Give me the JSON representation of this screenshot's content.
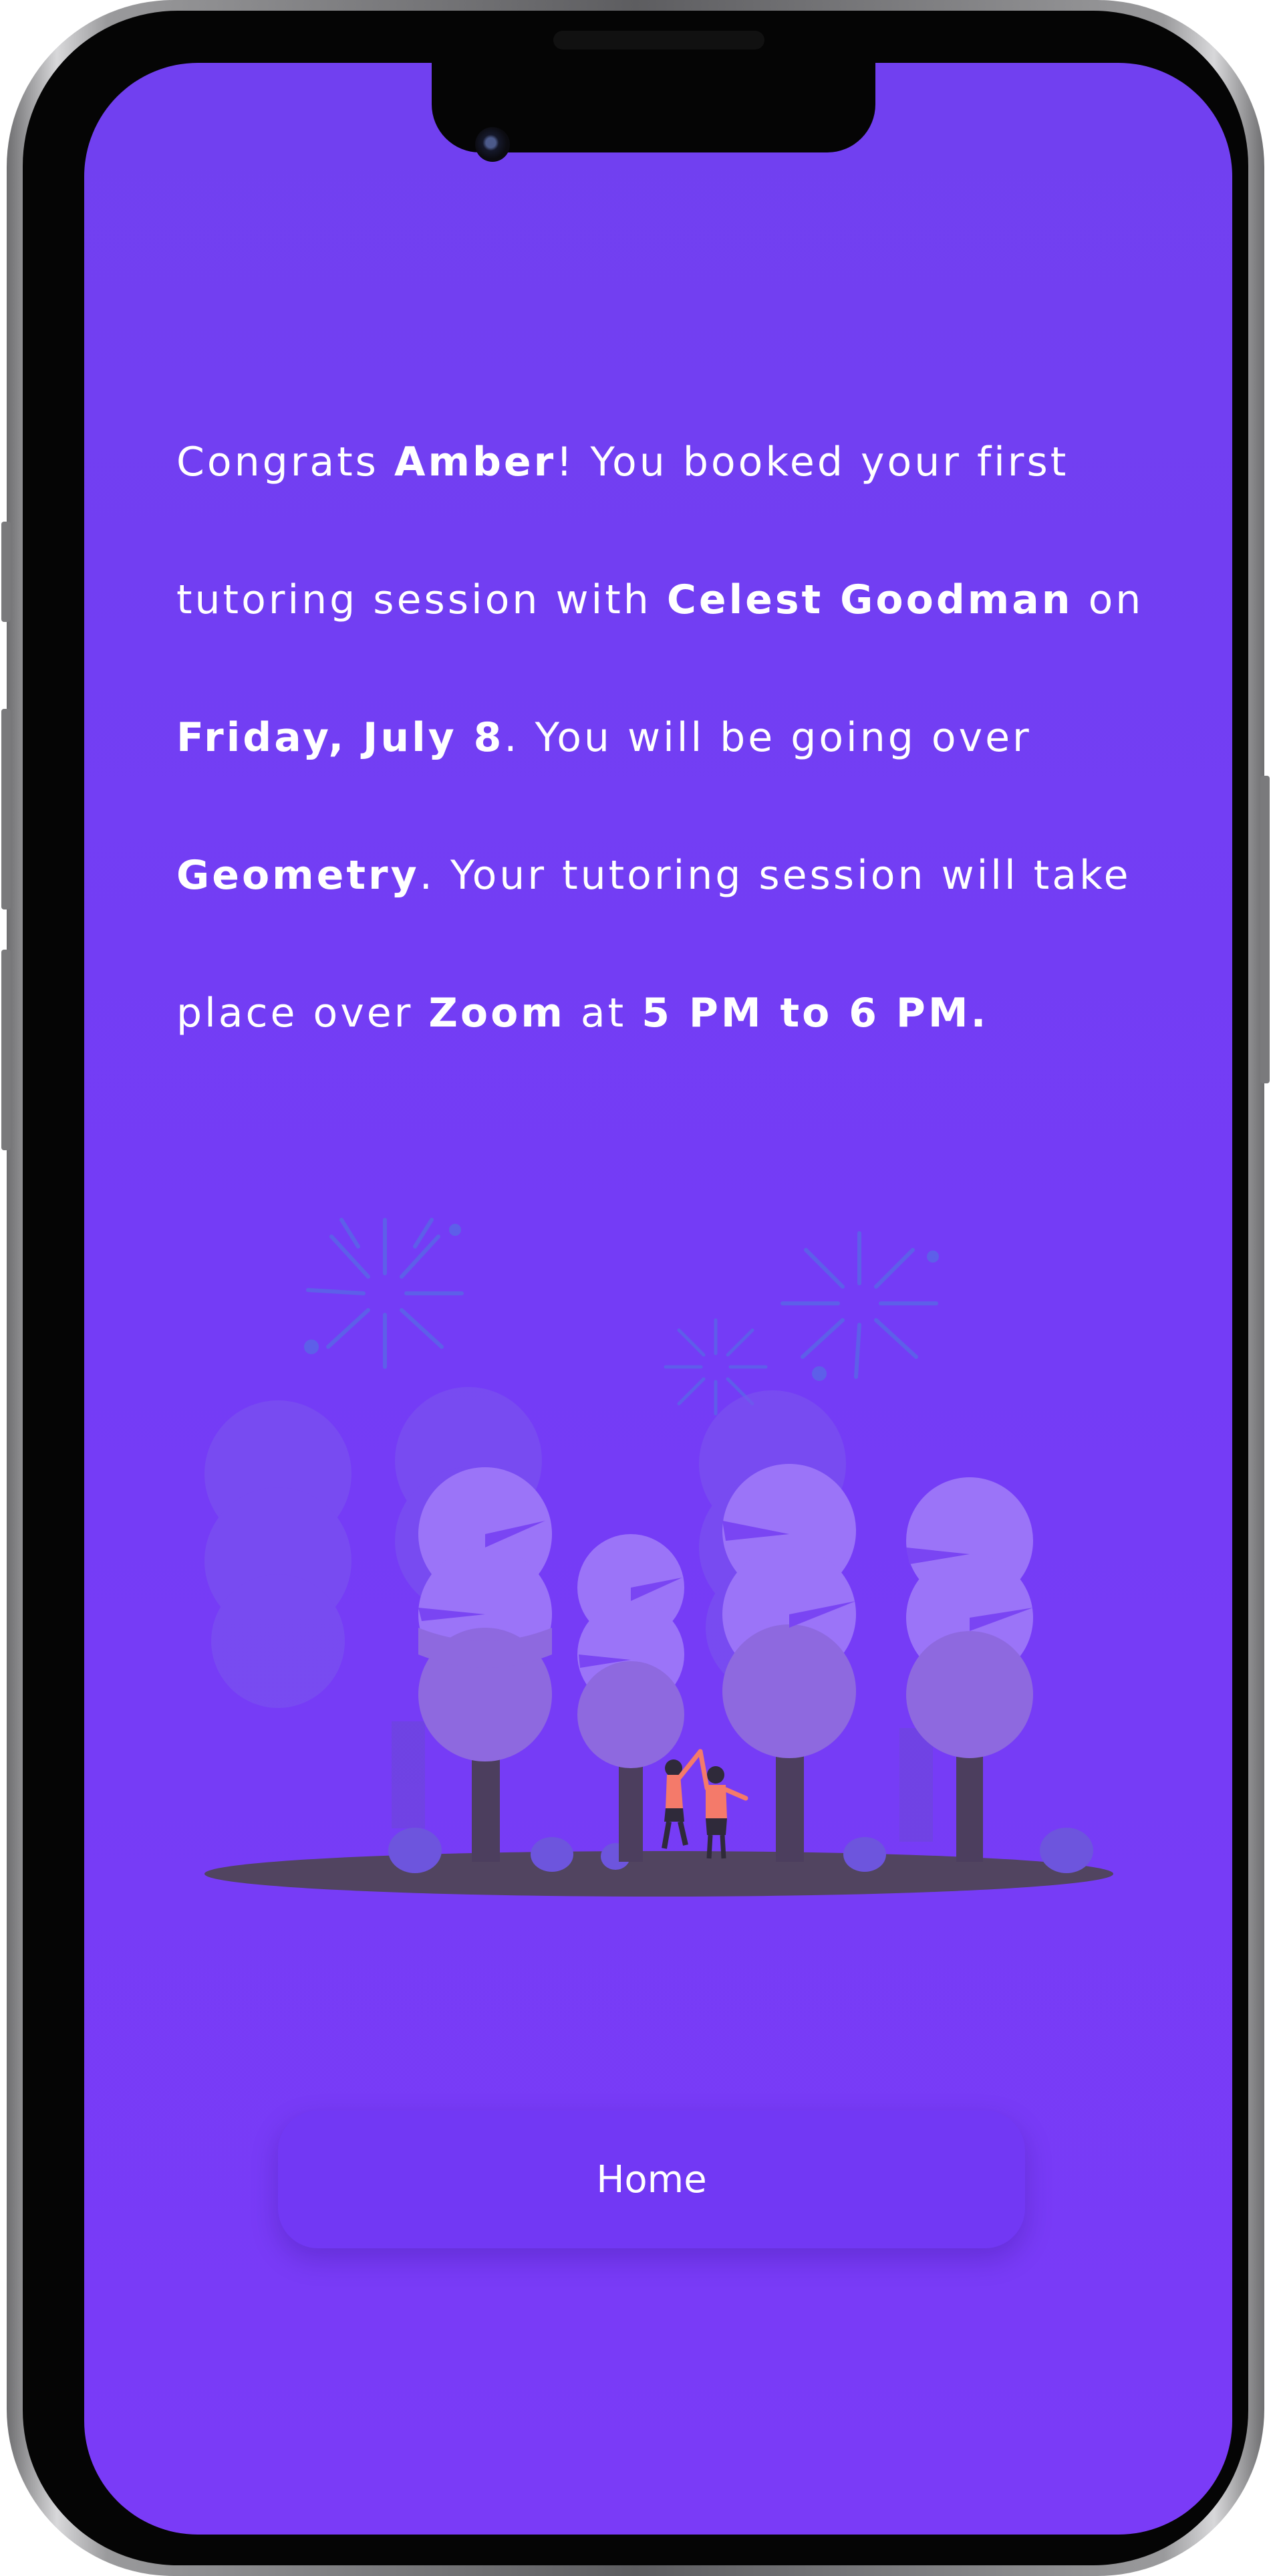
{
  "confirmation": {
    "congrats": "Congrats ",
    "student_name": "Amber",
    "booked_text": "! You booked your first tutoring session with ",
    "tutor_name": "Celest Goodman",
    "on_text": " on ",
    "date": "Friday, July 8",
    "going_over_text": ". You will be going over ",
    "subject": "Geometry",
    "session_text": ". Your tutoring session will take place over ",
    "platform": "Zoom",
    "at_text": " at ",
    "time": "5 PM to 6 PM."
  },
  "home_button": {
    "label": "Home"
  },
  "colors": {
    "background": "#743cf6",
    "button": "#7238f4",
    "text": "#ffffff",
    "tree": "#9b75f8",
    "ground": "#514460",
    "person_accent": "#f47a6a"
  },
  "illustration": {
    "icon": "celebration-trees-fireworks-illustration"
  }
}
